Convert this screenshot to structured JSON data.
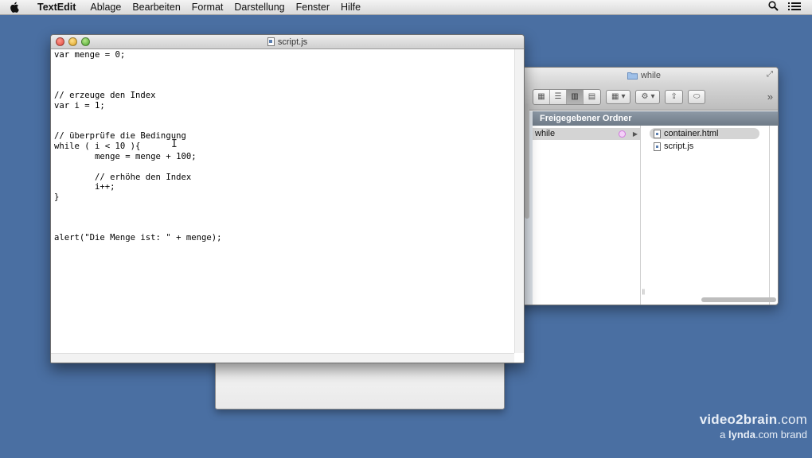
{
  "menubar": {
    "app_name": "TextEdit",
    "items": [
      "Ablage",
      "Bearbeiten",
      "Format",
      "Darstellung",
      "Fenster",
      "Hilfe"
    ]
  },
  "textedit": {
    "title": "script.js",
    "code": "var menge = 0;\n\n\n\n// erzeuge den Index\nvar i = 1;\n\n\n// überprüfe die Bedingung\nwhile ( i < 10 ){\n        menge = menge + 100;\n\n        // erhöhe den Index\n        i++;\n}\n\n\n\nalert(\"Die Menge ist: \" + menge);"
  },
  "finder": {
    "title": "while",
    "column_header": "Freigegebener Ordner",
    "column1_item": "while",
    "files": [
      "container.html",
      "script.js"
    ]
  },
  "watermark": {
    "brand_bold": "video2brain",
    "brand_suffix": ".com",
    "tagline_pre": "a ",
    "tagline_bold": "lynda",
    "tagline_post": ".com brand"
  }
}
